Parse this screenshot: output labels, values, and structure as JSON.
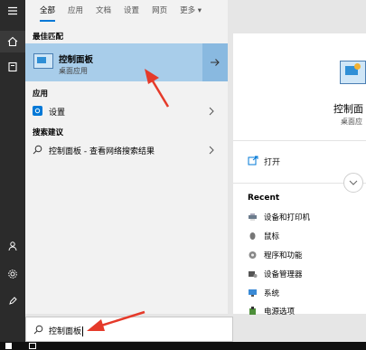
{
  "tabs": [
    "全部",
    "应用",
    "文档",
    "设置",
    "网页",
    "更多 ▾"
  ],
  "best_match": {
    "section_title": "最佳匹配",
    "title": "控制面板",
    "subtitle": "桌面应用"
  },
  "apps": {
    "section_title": "应用",
    "items": [
      {
        "label": "设置"
      }
    ]
  },
  "web": {
    "section_title": "搜索建议",
    "items": [
      {
        "label": "控制面板 - 查看网络搜索结果"
      }
    ]
  },
  "detail": {
    "app_name": "控制面",
    "app_type": "桌面应",
    "open_label": "打开",
    "recent_title": "Recent",
    "recent_items": [
      {
        "label": "设备和打印机",
        "icon": "printer-icon"
      },
      {
        "label": "鼠标",
        "icon": "mouse-icon"
      },
      {
        "label": "程序和功能",
        "icon": "programs-icon"
      },
      {
        "label": "设备管理器",
        "icon": "device-manager-icon"
      },
      {
        "label": "系统",
        "icon": "system-icon"
      },
      {
        "label": "电源选项",
        "icon": "power-icon"
      }
    ]
  },
  "search": {
    "value": "控制面板"
  },
  "colors": {
    "accent": "#0078d7",
    "selected_bg": "#a8cdea",
    "annotation_arrow": "#e53a2a"
  }
}
